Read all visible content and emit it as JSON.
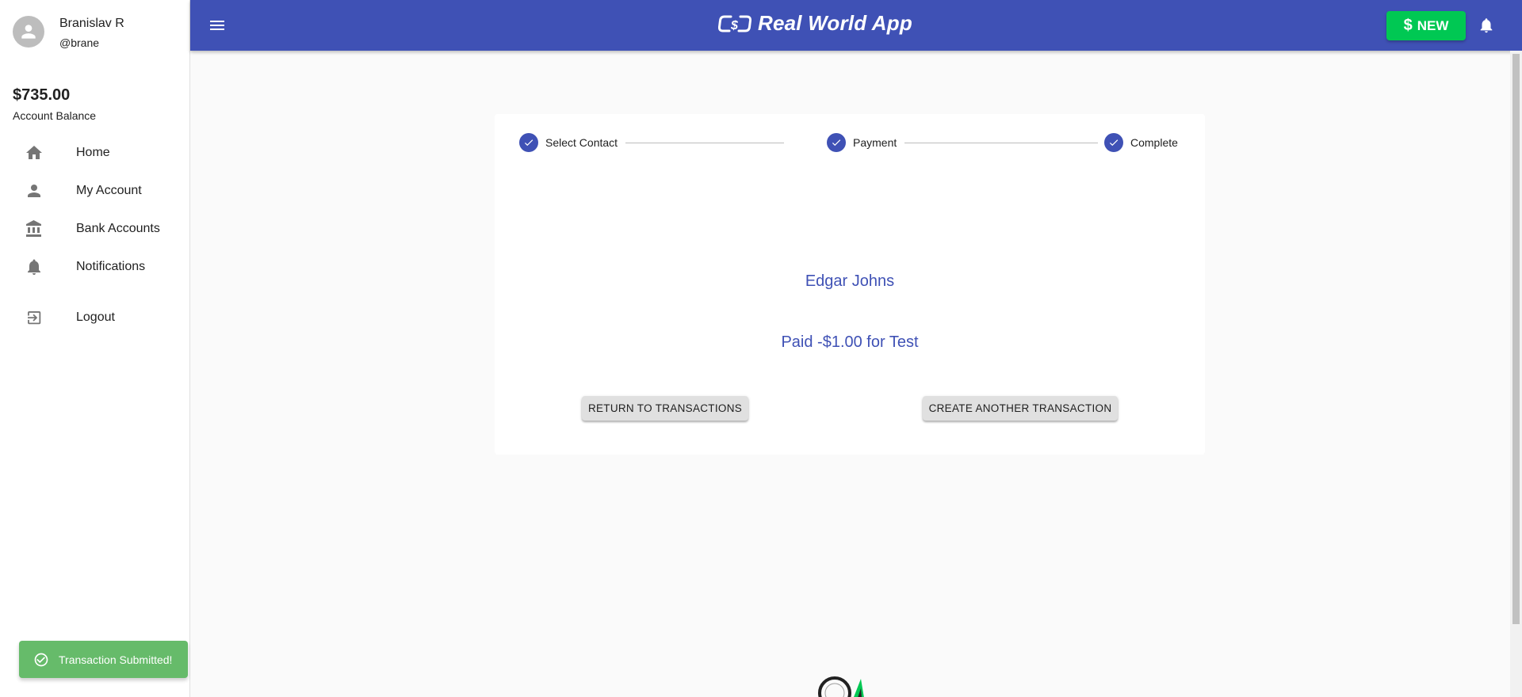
{
  "sidebar": {
    "user": {
      "name": "Branislav R",
      "handle": "@brane"
    },
    "balance": {
      "amount": "$735.00",
      "label": "Account Balance"
    },
    "nav": [
      {
        "label": "Home",
        "icon": "home-icon"
      },
      {
        "label": "My Account",
        "icon": "person-icon"
      },
      {
        "label": "Bank Accounts",
        "icon": "bank-icon"
      },
      {
        "label": "Notifications",
        "icon": "bell-icon"
      }
    ],
    "logout": {
      "label": "Logout",
      "icon": "logout-icon"
    }
  },
  "header": {
    "title": "Real World App",
    "new_button": {
      "symbol": "$",
      "label": "NEW"
    }
  },
  "stepper": {
    "steps": [
      {
        "label": "Select Contact",
        "completed": true
      },
      {
        "label": "Payment",
        "completed": true
      },
      {
        "label": "Complete",
        "completed": true
      }
    ]
  },
  "transaction": {
    "recipient": "Edgar Johns",
    "summary": "Paid -$1.00 for Test"
  },
  "actions": {
    "return_label": "RETURN TO TRANSACTIONS",
    "create_label": "CREATE ANOTHER TRANSACTION"
  },
  "toast": {
    "message": "Transaction Submitted!"
  },
  "colors": {
    "primary": "#3f51b5",
    "new_button": "#00c853",
    "toast": "#66bb6a",
    "button_bg": "#e0e0e0"
  }
}
